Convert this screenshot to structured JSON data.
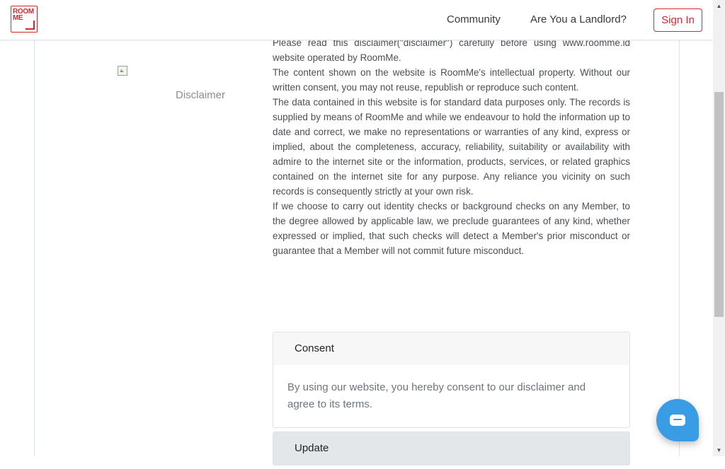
{
  "header": {
    "logo_text_line1": "ROOM",
    "logo_text_line2": "ME",
    "nav": {
      "community": "Community",
      "landlord": "Are You a Landlord?",
      "signin": "Sign In"
    },
    "brand_color": "#d7282f"
  },
  "side": {
    "image_alt": "Disclaimer"
  },
  "content": {
    "paragraphs": [
      "Please read this disclaimer(\"disclaimer\") carefully before using www.roomme.id website operated by RoomMe.",
      "The content shown on the website is RoomMe's intellectual property. Without our written consent, you may not reuse, republish or reproduce such content.",
      "The data contained in this website is for standard data purposes only. The records is supplied by means of RoomMe and while we endeavour to hold the information up to date and correct, we make no representations or warranties of any kind, express or implied, about the completeness, accuracy, reliability, suitability or availability with admire to the internet site or the information, products, services, or related graphics contained on the internet site for any purpose. Any reliance you vicinity on such records is consequently strictly at your own risk.",
      "If we choose to carry out identity checks or background checks on any Member, to the degree allowed by applicable law, we preclude guarantees of any kind, whether expressed or implied, that such checks will detect a Member's prior misconduct or guarantee that a Member will not commit future misconduct."
    ]
  },
  "accordion": {
    "consent": {
      "title": "Consent",
      "body": "By using our website, you hereby consent to our disclaimer and agree to its terms."
    },
    "update": {
      "title": "Update"
    }
  },
  "chat": {
    "icon": "chat-bubble-icon",
    "color": "#3b9ce6"
  }
}
